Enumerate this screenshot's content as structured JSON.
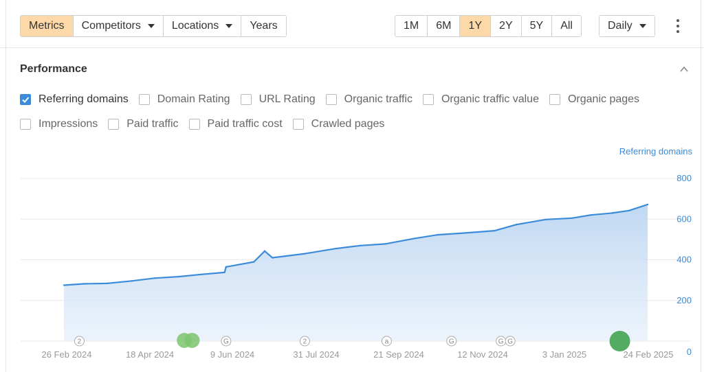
{
  "toolbar": {
    "view_tabs": [
      {
        "label": "Metrics",
        "active": true,
        "dropdown": false
      },
      {
        "label": "Competitors",
        "active": false,
        "dropdown": true
      },
      {
        "label": "Locations",
        "active": false,
        "dropdown": true
      },
      {
        "label": "Years",
        "active": false,
        "dropdown": false
      }
    ],
    "ranges": [
      {
        "label": "1M",
        "active": false
      },
      {
        "label": "6M",
        "active": false
      },
      {
        "label": "1Y",
        "active": true
      },
      {
        "label": "2Y",
        "active": false
      },
      {
        "label": "5Y",
        "active": false
      },
      {
        "label": "All",
        "active": false
      }
    ],
    "granularity": "Daily",
    "active_color": "#fdd9a9"
  },
  "section": {
    "title": "Performance"
  },
  "metrics": [
    {
      "label": "Referring domains",
      "checked": true
    },
    {
      "label": "Domain Rating",
      "checked": false
    },
    {
      "label": "URL Rating",
      "checked": false
    },
    {
      "label": "Organic traffic",
      "checked": false
    },
    {
      "label": "Organic traffic value",
      "checked": false
    },
    {
      "label": "Organic pages",
      "checked": false
    },
    {
      "label": "Impressions",
      "checked": false
    },
    {
      "label": "Paid traffic",
      "checked": false
    },
    {
      "label": "Paid traffic cost",
      "checked": false
    },
    {
      "label": "Crawled pages",
      "checked": false
    }
  ],
  "chart_data": {
    "type": "area",
    "series": [
      {
        "name": "Referring domains",
        "color": "#3b8bd9",
        "x": [
          "2024-02-26",
          "2024-03-10",
          "2024-03-25",
          "2024-04-10",
          "2024-04-25",
          "2024-05-10",
          "2024-05-25",
          "2024-06-09",
          "2024-06-10",
          "2024-06-28",
          "2024-07-05",
          "2024-07-10",
          "2024-07-31",
          "2024-08-20",
          "2024-09-05",
          "2024-09-21",
          "2024-10-10",
          "2024-10-25",
          "2024-11-12",
          "2024-12-01",
          "2024-12-15",
          "2025-01-03",
          "2025-01-20",
          "2025-02-01",
          "2025-02-15",
          "2025-02-26",
          "2025-03-10"
        ],
        "values": [
          275,
          282,
          284,
          296,
          310,
          317,
          328,
          338,
          365,
          390,
          443,
          410,
          430,
          455,
          470,
          478,
          505,
          523,
          532,
          543,
          573,
          598,
          605,
          620,
          630,
          642,
          672
        ]
      }
    ],
    "x_ticks": [
      "26 Feb 2024",
      "18 Apr 2024",
      "9 Jun 2024",
      "31 Jul 2024",
      "21 Sep 2024",
      "12 Nov 2024",
      "3 Jan 2025",
      "24 Feb 2025"
    ],
    "ylabel": "Referring domains",
    "y_ticks": [
      0,
      200,
      400,
      600,
      800
    ],
    "ylim": [
      0,
      800
    ],
    "grid": true,
    "annotations": [
      {
        "date": "2024-03-07",
        "kind": "marker",
        "text": "2"
      },
      {
        "date": "2024-05-14",
        "kind": "event",
        "text": ""
      },
      {
        "date": "2024-05-19",
        "kind": "event",
        "text": ""
      },
      {
        "date": "2024-06-10",
        "kind": "marker",
        "text": "G"
      },
      {
        "date": "2024-07-31",
        "kind": "marker",
        "text": "2"
      },
      {
        "date": "2024-09-22",
        "kind": "marker",
        "text": "a"
      },
      {
        "date": "2024-11-03",
        "kind": "marker",
        "text": "G"
      },
      {
        "date": "2024-12-05",
        "kind": "marker",
        "text": "G"
      },
      {
        "date": "2024-12-11",
        "kind": "marker",
        "text": "G"
      },
      {
        "date": "2025-02-20",
        "kind": "event",
        "text": ""
      }
    ]
  }
}
